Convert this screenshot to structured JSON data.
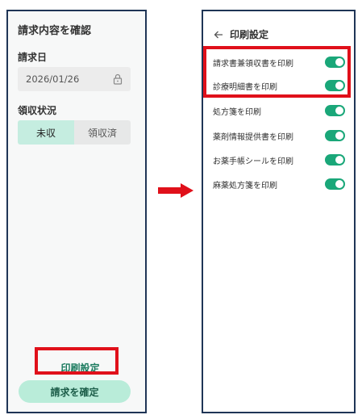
{
  "left_panel": {
    "title": "請求内容を確認",
    "billing_date_label": "請求日",
    "billing_date_value": "2026/01/26",
    "receipt_status_label": "領収状況",
    "status_options": [
      "未収",
      "領収済"
    ],
    "status_selected": "未収",
    "print_settings_label": "印刷設定",
    "confirm_button_label": "請求を確定"
  },
  "right_panel": {
    "title": "印刷設定",
    "options": [
      {
        "label": "請求書兼領収書を印刷",
        "enabled": true
      },
      {
        "label": "診療明細書を印刷",
        "enabled": true
      },
      {
        "label": "処方箋を印刷",
        "enabled": true
      },
      {
        "label": "薬剤情報提供書を印刷",
        "enabled": true
      },
      {
        "label": "お薬手帳シールを印刷",
        "enabled": true
      },
      {
        "label": "麻薬処方箋を印刷",
        "enabled": true
      }
    ]
  },
  "icons": {
    "lock": "lock-icon",
    "back": "arrow-left-icon",
    "transition": "arrow-right-icon"
  },
  "colors": {
    "accent": "#1aa779",
    "highlight": "#e0101a",
    "panel_border": "#1f3556",
    "confirm_button": "#b9ecd9",
    "segment_active": "#c5ede0"
  }
}
